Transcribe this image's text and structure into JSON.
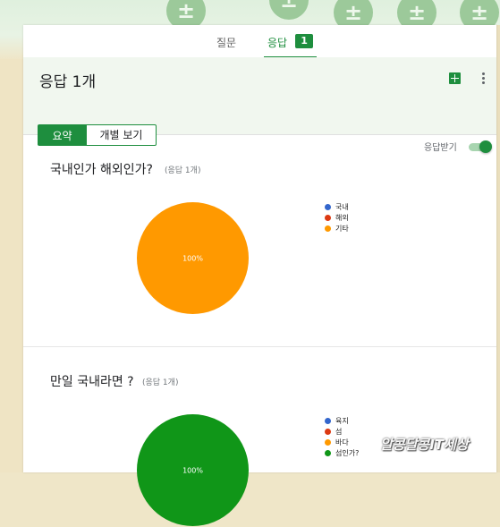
{
  "tabs": {
    "questions": "질문",
    "responses": "응답",
    "response_count": "1"
  },
  "header": {
    "title": "응답 1개",
    "summary_tab": "요약",
    "individual_tab": "개별 보기",
    "accepting_label": "응답받기",
    "accepting": true
  },
  "icons": {
    "sheets": "sheets-icon",
    "more": "more-vert-icon"
  },
  "questions": [
    {
      "title": "국내인가 해외인가?",
      "count": "(응답 1개)",
      "chart_data": {
        "type": "pie",
        "categories": [
          "국내",
          "해외",
          "기타"
        ],
        "values": [
          0,
          0,
          100
        ],
        "colors": [
          "#3366cc",
          "#dc3912",
          "#ff9900"
        ],
        "slice_labels": [
          "100%"
        ],
        "legend": "right"
      }
    },
    {
      "title": "만일 국내라면 ?",
      "count": "(응답 1개)",
      "chart_data": {
        "type": "pie",
        "categories": [
          "육지",
          "섬",
          "바다",
          "섬인가?"
        ],
        "values": [
          0,
          0,
          0,
          100
        ],
        "colors": [
          "#3366cc",
          "#dc3912",
          "#ff9900",
          "#109618"
        ],
        "slice_labels": [
          "100%"
        ],
        "legend": "right"
      }
    }
  ],
  "watermark": "알콩달콩IT세상"
}
